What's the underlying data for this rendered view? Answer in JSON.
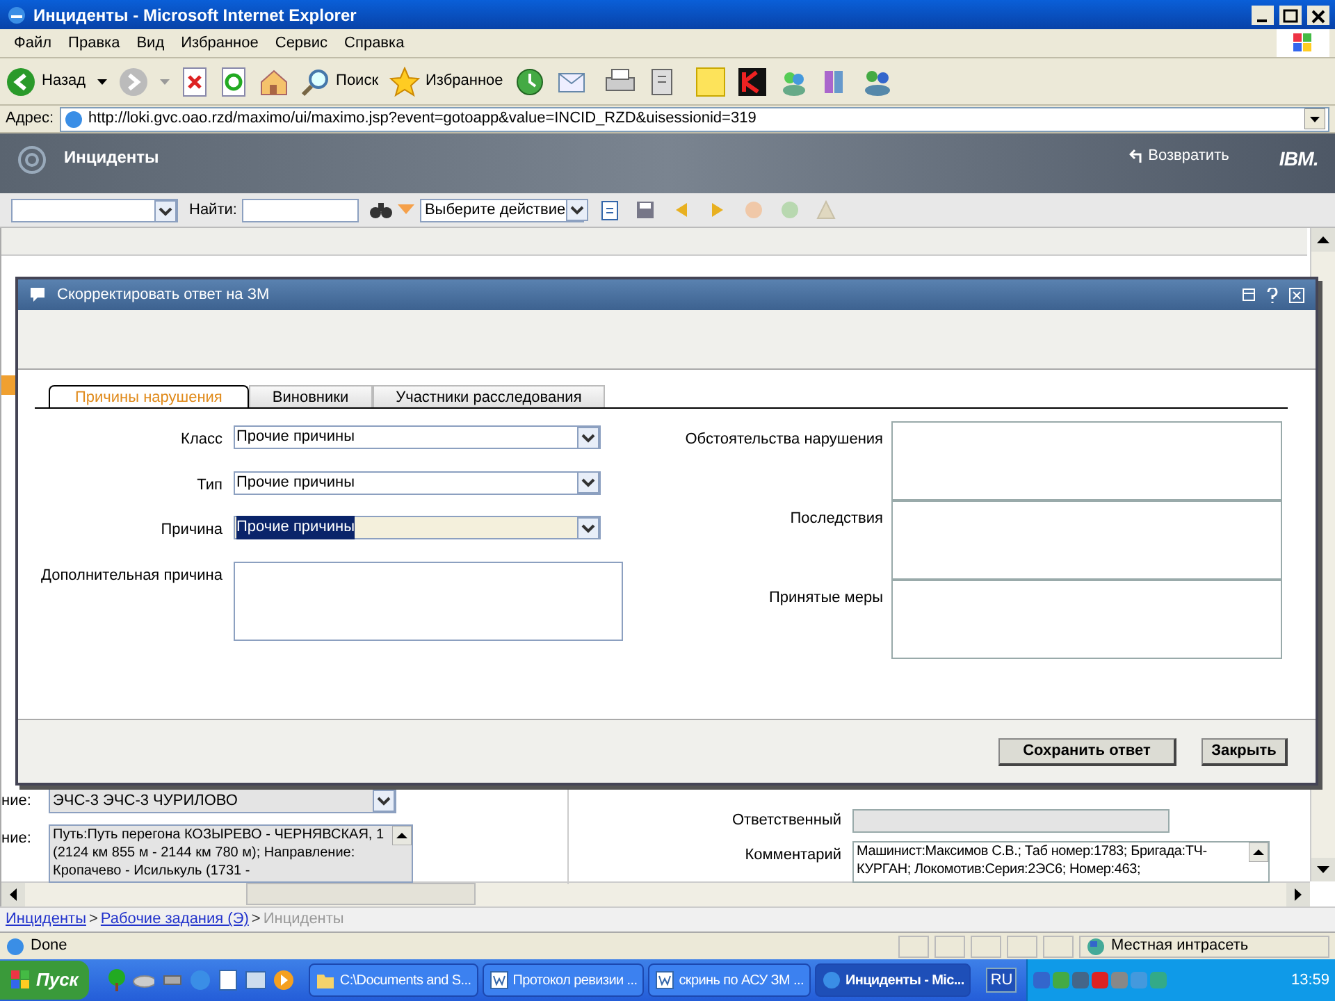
{
  "window": {
    "title": "Инциденты - Microsoft Internet Explorer"
  },
  "menu": [
    "Файл",
    "Правка",
    "Вид",
    "Избранное",
    "Сервис",
    "Справка"
  ],
  "toolbar": {
    "back": "Назад",
    "search": "Поиск",
    "favorites": "Избранное"
  },
  "address": {
    "label": "Адрес:",
    "url": "http://loki.gvc.oao.rzd/maximo/ui/maximo.jsp?event=gotoapp&value=INCID_RZD&uisessionid=319"
  },
  "app": {
    "title": "Инциденты",
    "return": "Возвратить",
    "logo": "IBM."
  },
  "app_toolbar": {
    "find_label": "Найти:",
    "action": "Выберите действие"
  },
  "background": {
    "department_label": "ние:",
    "department": "ЭЧС-3 ЭЧС-3 ЧУРИЛОВО",
    "location_label": "ние:",
    "location": "Путь:Путь перегона КОЗЫРЕВО - ЧЕРНЯВСКАЯ, 1 (2124 км 855 м - 2144 км 780 м); Направление: Кропачево - Исилькуль (1731 -",
    "responsible_label": "Ответственный",
    "comment_label": "Комментарий",
    "comment": "Машинист:Максимов С.В.; Таб номер:1783; Бригада:ТЧ-КУРГАН; Локомотив:Серия:2ЭС6; Номер:463;"
  },
  "dialog": {
    "title": "Скорректировать ответ на ЗМ",
    "tabs": [
      {
        "label": "Причины нарушения",
        "selected": true
      },
      {
        "label": "Виновники",
        "selected": false
      },
      {
        "label": "Участники расследования",
        "selected": false
      }
    ],
    "left_fields": [
      {
        "kind": "select",
        "label": "Класс",
        "value": "Прочие причины",
        "focused": false
      },
      {
        "kind": "select",
        "label": "Тип",
        "value": "Прочие причины",
        "focused": false
      },
      {
        "kind": "select",
        "label": "Причина",
        "value": "Прочие причины",
        "focused": true
      },
      {
        "kind": "textarea",
        "label": "Дополнительная причина",
        "focused": false
      }
    ],
    "right_fields": [
      {
        "label": "Обстоятельства нарушения"
      },
      {
        "label": "Последствия"
      },
      {
        "label": "Принятые меры"
      }
    ],
    "buttons": [
      "Сохранить ответ",
      "Закрыть"
    ]
  },
  "breadcrumb": [
    {
      "kind": "link",
      "label": "Инциденты"
    },
    {
      "kind": "separator",
      "label": ">"
    },
    {
      "kind": "link",
      "label": "Рабочие задания (Э)"
    },
    {
      "kind": "separator",
      "label": ">"
    },
    {
      "kind": "current",
      "label": "Инциденты"
    }
  ],
  "status": {
    "text": "Done",
    "zone": "Местная интрасеть"
  },
  "taskbar": {
    "start": "Пуск",
    "tasks": [
      {
        "label": "C:\\Documents and S...",
        "selected": false
      },
      {
        "label": "Протокол ревизии ...",
        "selected": false
      },
      {
        "label": "скринь по АСУ ЗМ ...",
        "selected": false
      },
      {
        "label": "Инциденты - Mic...",
        "selected": true
      }
    ],
    "lang": "RU",
    "clock": "13:59"
  }
}
